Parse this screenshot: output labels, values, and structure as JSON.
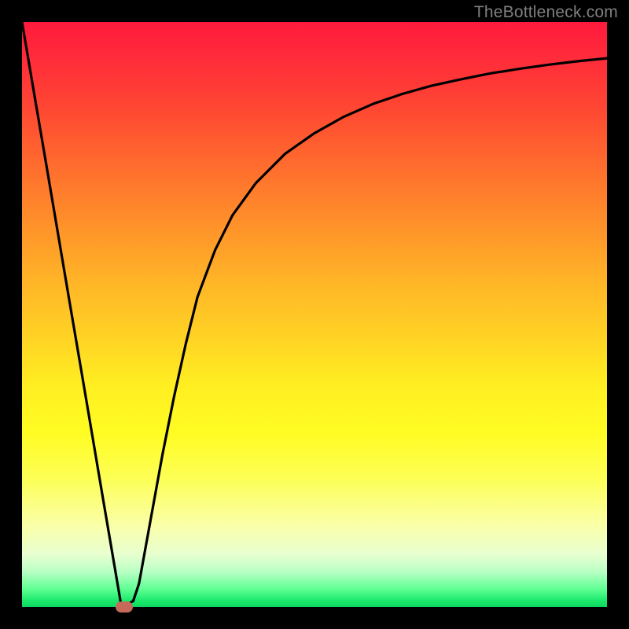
{
  "watermark": "TheBottleneck.com",
  "colors": {
    "frame": "#000000",
    "watermark": "#7f7f7f",
    "curve": "#000000",
    "marker": "#c56a5b"
  },
  "chart_data": {
    "type": "line",
    "title": "",
    "xlabel": "",
    "ylabel": "",
    "xlim": [
      0,
      100
    ],
    "ylim": [
      0,
      100
    ],
    "grid": false,
    "legend": false,
    "series": [
      {
        "name": "curve",
        "x": [
          0,
          2,
          4,
          6,
          8,
          10,
          12,
          14,
          16,
          17,
          18,
          19,
          20,
          22,
          24,
          26,
          28,
          30,
          33,
          36,
          40,
          45,
          50,
          55,
          60,
          65,
          70,
          75,
          80,
          85,
          90,
          95,
          100
        ],
        "y": [
          100,
          88.2,
          76.5,
          64.7,
          52.9,
          41.2,
          29.4,
          17.6,
          5.9,
          0.0,
          0.5,
          1.0,
          4.0,
          15.0,
          26.0,
          36.0,
          45.0,
          53.0,
          61.0,
          67.0,
          72.5,
          77.5,
          81.0,
          83.8,
          86.0,
          87.7,
          89.1,
          90.2,
          91.2,
          92.0,
          92.7,
          93.3,
          93.8
        ]
      }
    ],
    "marker": {
      "x": 17.5,
      "y": 0,
      "shape": "pill"
    }
  }
}
